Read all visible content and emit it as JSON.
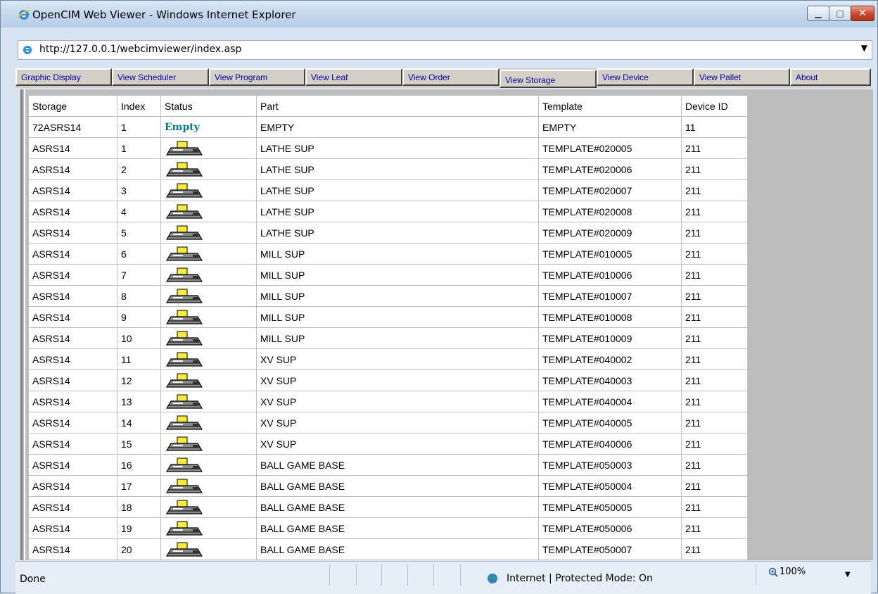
{
  "window": {
    "title": "OpenCIM Web Viewer - Windows Internet Explorer",
    "minimize_icon": "minimize-icon",
    "maximize_icon": "maximize-icon",
    "close_icon": "close-icon"
  },
  "address": {
    "url": "http://127.0.0.1/webcimviewer/index.asp"
  },
  "tabs": [
    {
      "label": "Graphic Display",
      "active": false
    },
    {
      "label": "View Scheduler",
      "active": false
    },
    {
      "label": "View Program",
      "active": false
    },
    {
      "label": "View Leaf",
      "active": false
    },
    {
      "label": "View Order",
      "active": false
    },
    {
      "label": "View Storage",
      "active": true
    },
    {
      "label": "View Device",
      "active": false
    },
    {
      "label": "View Pallet",
      "active": false
    },
    {
      "label": "About",
      "active": false
    }
  ],
  "table": {
    "columns": [
      "Storage",
      "Index",
      "Status",
      "Part",
      "Template",
      "Device ID"
    ],
    "rows": [
      {
        "storage": "72ASRS14",
        "index": "1",
        "status": "Empty",
        "status_icon": null,
        "part": "EMPTY",
        "template": "EMPTY",
        "device_id": "11"
      },
      {
        "storage": "ASRS14",
        "index": "1",
        "status": "",
        "status_icon": "pallet-icon",
        "part": "LATHE SUP",
        "template": "TEMPLATE#020005",
        "device_id": "211"
      },
      {
        "storage": "ASRS14",
        "index": "2",
        "status": "",
        "status_icon": "pallet-icon",
        "part": "LATHE SUP",
        "template": "TEMPLATE#020006",
        "device_id": "211"
      },
      {
        "storage": "ASRS14",
        "index": "3",
        "status": "",
        "status_icon": "pallet-icon",
        "part": "LATHE SUP",
        "template": "TEMPLATE#020007",
        "device_id": "211"
      },
      {
        "storage": "ASRS14",
        "index": "4",
        "status": "",
        "status_icon": "pallet-icon",
        "part": "LATHE SUP",
        "template": "TEMPLATE#020008",
        "device_id": "211"
      },
      {
        "storage": "ASRS14",
        "index": "5",
        "status": "",
        "status_icon": "pallet-icon",
        "part": "LATHE SUP",
        "template": "TEMPLATE#020009",
        "device_id": "211"
      },
      {
        "storage": "ASRS14",
        "index": "6",
        "status": "",
        "status_icon": "pallet-icon",
        "part": "MILL SUP",
        "template": "TEMPLATE#010005",
        "device_id": "211"
      },
      {
        "storage": "ASRS14",
        "index": "7",
        "status": "",
        "status_icon": "pallet-icon",
        "part": "MILL SUP",
        "template": "TEMPLATE#010006",
        "device_id": "211"
      },
      {
        "storage": "ASRS14",
        "index": "8",
        "status": "",
        "status_icon": "pallet-icon",
        "part": "MILL SUP",
        "template": "TEMPLATE#010007",
        "device_id": "211"
      },
      {
        "storage": "ASRS14",
        "index": "9",
        "status": "",
        "status_icon": "pallet-icon",
        "part": "MILL SUP",
        "template": "TEMPLATE#010008",
        "device_id": "211"
      },
      {
        "storage": "ASRS14",
        "index": "10",
        "status": "",
        "status_icon": "pallet-icon",
        "part": "MILL SUP",
        "template": "TEMPLATE#010009",
        "device_id": "211"
      },
      {
        "storage": "ASRS14",
        "index": "11",
        "status": "",
        "status_icon": "pallet-icon",
        "part": "XV SUP",
        "template": "TEMPLATE#040002",
        "device_id": "211"
      },
      {
        "storage": "ASRS14",
        "index": "12",
        "status": "",
        "status_icon": "pallet-icon",
        "part": "XV SUP",
        "template": "TEMPLATE#040003",
        "device_id": "211"
      },
      {
        "storage": "ASRS14",
        "index": "13",
        "status": "",
        "status_icon": "pallet-icon",
        "part": "XV SUP",
        "template": "TEMPLATE#040004",
        "device_id": "211"
      },
      {
        "storage": "ASRS14",
        "index": "14",
        "status": "",
        "status_icon": "pallet-icon",
        "part": "XV SUP",
        "template": "TEMPLATE#040005",
        "device_id": "211"
      },
      {
        "storage": "ASRS14",
        "index": "15",
        "status": "",
        "status_icon": "pallet-icon",
        "part": "XV SUP",
        "template": "TEMPLATE#040006",
        "device_id": "211"
      },
      {
        "storage": "ASRS14",
        "index": "16",
        "status": "",
        "status_icon": "pallet-icon",
        "part": "BALL GAME BASE",
        "template": "TEMPLATE#050003",
        "device_id": "211"
      },
      {
        "storage": "ASRS14",
        "index": "17",
        "status": "",
        "status_icon": "pallet-icon",
        "part": "BALL GAME BASE",
        "template": "TEMPLATE#050004",
        "device_id": "211"
      },
      {
        "storage": "ASRS14",
        "index": "18",
        "status": "",
        "status_icon": "pallet-icon",
        "part": "BALL GAME BASE",
        "template": "TEMPLATE#050005",
        "device_id": "211"
      },
      {
        "storage": "ASRS14",
        "index": "19",
        "status": "",
        "status_icon": "pallet-icon",
        "part": "BALL GAME BASE",
        "template": "TEMPLATE#050006",
        "device_id": "211"
      },
      {
        "storage": "ASRS14",
        "index": "20",
        "status": "",
        "status_icon": "pallet-icon",
        "part": "BALL GAME BASE",
        "template": "TEMPLATE#050007",
        "device_id": "211"
      }
    ]
  },
  "status_bar": {
    "text": "Done",
    "zone": "Internet | Protected Mode: On",
    "zoom": "100%"
  },
  "colors": {
    "tab_text": "#0000a0",
    "empty_status": "#0a7a8a",
    "panel_gray": "#bdbdbd"
  }
}
